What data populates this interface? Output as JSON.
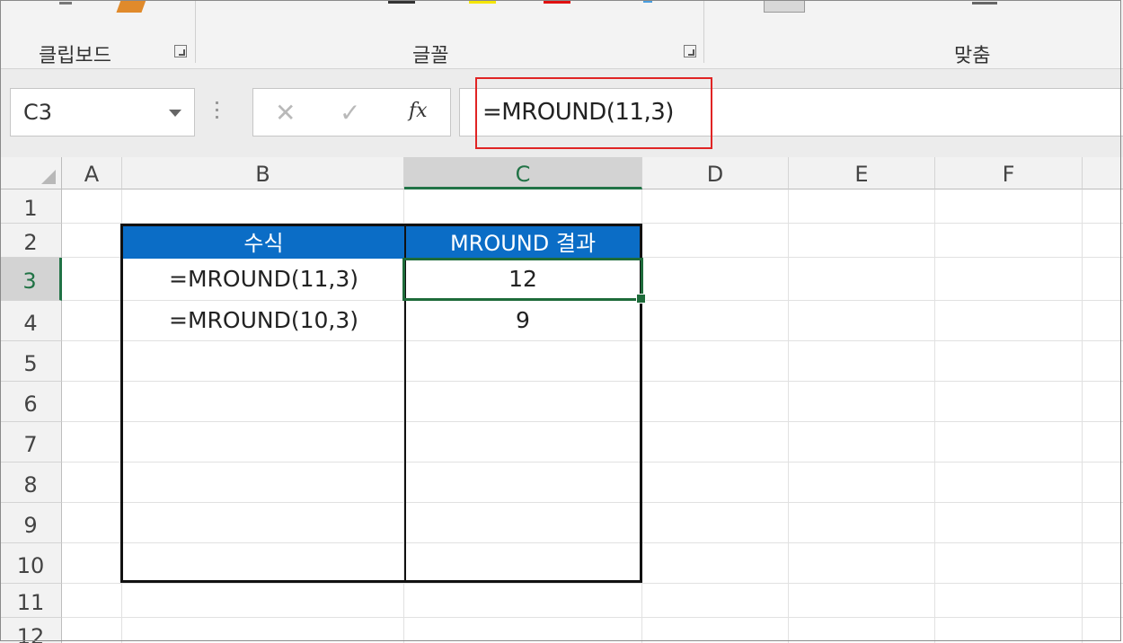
{
  "ribbon": {
    "groups": [
      {
        "label": "클립보드"
      },
      {
        "label": "글꼴"
      },
      {
        "label": "맞춤"
      }
    ]
  },
  "formula_bar": {
    "name_box": "C3",
    "cancel_glyph": "✕",
    "enter_glyph": "✓",
    "fx_label": "fx",
    "formula": "=MROUND(11,3)"
  },
  "grid": {
    "columns": [
      "A",
      "B",
      "C",
      "D",
      "E",
      "F"
    ],
    "rows": [
      "1",
      "2",
      "3",
      "4",
      "5",
      "6",
      "7",
      "8",
      "9",
      "10",
      "11",
      "12"
    ],
    "selected_column": "C",
    "selected_row": "3"
  },
  "table": {
    "headers": [
      "수식",
      "MROUND 결과"
    ],
    "rows": [
      {
        "formula": "=MROUND(11,3)",
        "result": "12"
      },
      {
        "formula": "=MROUND(10,3)",
        "result": "9"
      }
    ],
    "header_color": "#0b6dc6"
  },
  "colors": {
    "excel_green": "#217346",
    "highlight_red": "#e02424"
  }
}
